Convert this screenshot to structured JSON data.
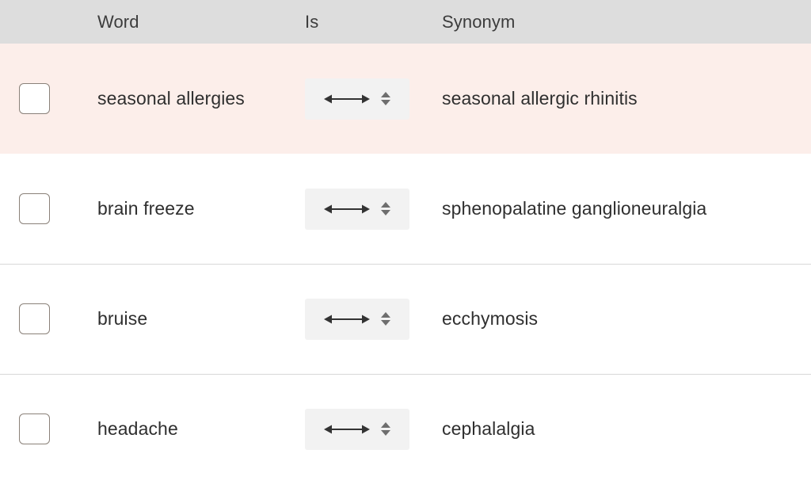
{
  "table": {
    "columns": [
      {
        "key": "select",
        "label": ""
      },
      {
        "key": "word",
        "label": "Word"
      },
      {
        "key": "is",
        "label": "Is"
      },
      {
        "key": "synonym",
        "label": "Synonym"
      }
    ],
    "header": {
      "word_label": "Word",
      "is_label": "Is",
      "synonym_label": "Synonym"
    },
    "rows": [
      {
        "word": "seasonal allergies",
        "relation": "↔",
        "relation_name": "bidirectional-synonym",
        "synonym": "seasonal allergic rhinitis",
        "checked": false,
        "highlighted": true
      },
      {
        "word": "brain freeze",
        "relation": "↔",
        "relation_name": "bidirectional-synonym",
        "synonym": "sphenopalatine ganglioneuralgia",
        "checked": false,
        "highlighted": false
      },
      {
        "word": "bruise",
        "relation": "↔",
        "relation_name": "bidirectional-synonym",
        "synonym": "ecchymosis",
        "checked": false,
        "highlighted": false
      },
      {
        "word": "headache",
        "relation": "↔",
        "relation_name": "bidirectional-synonym",
        "synonym": "cephalalgia",
        "checked": false,
        "highlighted": false
      }
    ]
  },
  "icons": {
    "bidirectional_arrow": "two-way-arrow-icon",
    "stepper": "select-stepper-icon",
    "checkbox": "row-checkbox"
  },
  "colors": {
    "header_background": "#dddddd",
    "row_background": "#ffffff",
    "row_highlight_background": "#fceeea",
    "select_background": "#f2f2f2",
    "divider": "#d8d8d8",
    "text": "#2f2f2f",
    "header_text": "#3c3c3c",
    "checkbox_border": "#8a8179",
    "arrow": "#333333",
    "stepper": "#6e6e6e"
  }
}
